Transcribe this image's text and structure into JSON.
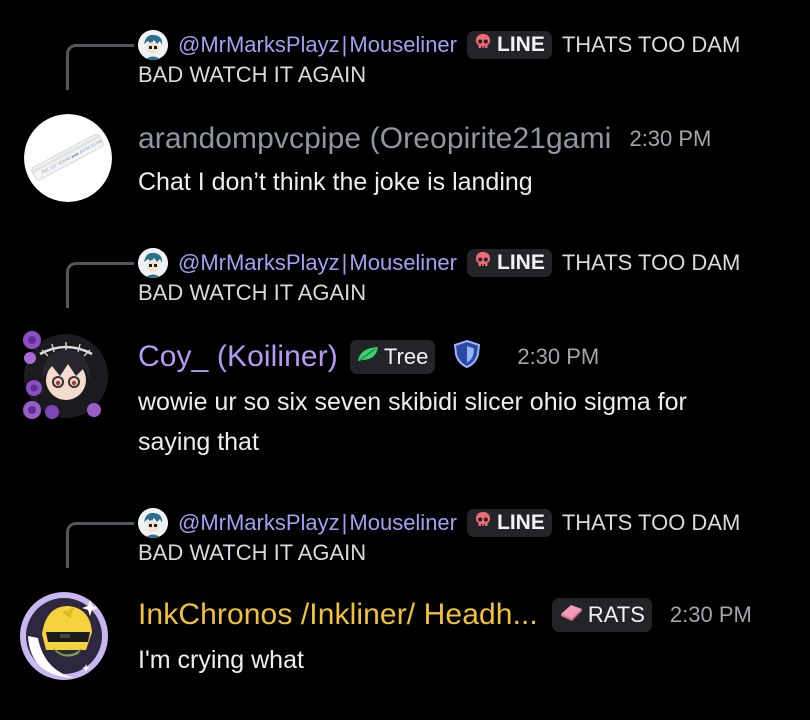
{
  "messages": [
    {
      "reply": {
        "name": "@MrMarksPlayz",
        "sep": "|",
        "alias": "Mouseliner",
        "tag": "LINE",
        "tag_icon": "skull-icon",
        "text": "THATS TOO DAM",
        "text_cont": "BAD WATCH IT AGAIN"
      },
      "author": "arandompvcpipe (Oreopirite21gami",
      "author_color": "#8f96a3",
      "time": "2:30 PM",
      "lines": [
        "Chat I don’t think the joke is landing"
      ]
    },
    {
      "reply": {
        "name": "@MrMarksPlayz",
        "sep": "|",
        "alias": "Mouseliner",
        "tag": "LINE",
        "tag_icon": "skull-icon",
        "text": "THATS TOO DAM",
        "text_cont": "BAD WATCH IT AGAIN"
      },
      "author": "Coy_ (Koiliner)",
      "author_color": "#b49af5",
      "tag": "Tree",
      "tag_icon": "leaf-icon",
      "badge_icon": "shield-icon",
      "time": "2:30 PM",
      "lines": [
        "wowie ur so six seven skibidi slicer ohio sigma for",
        "saying that"
      ]
    },
    {
      "reply": {
        "name": "@MrMarksPlayz",
        "sep": "|",
        "alias": "Mouseliner",
        "tag": "LINE",
        "tag_icon": "skull-icon",
        "text": "THATS TOO DAM",
        "text_cont": "BAD WATCH IT AGAIN"
      },
      "author": "InkChronos /Inkliner/ Headh...",
      "author_color": "#f1c232",
      "tag": "RATS",
      "tag_icon": "eraser-icon",
      "time": "2:30 PM",
      "lines": [
        "I'm crying what"
      ]
    }
  ],
  "colors": {
    "background": "#000000",
    "mention": "#a39ff2",
    "skull": "#f06a78"
  }
}
